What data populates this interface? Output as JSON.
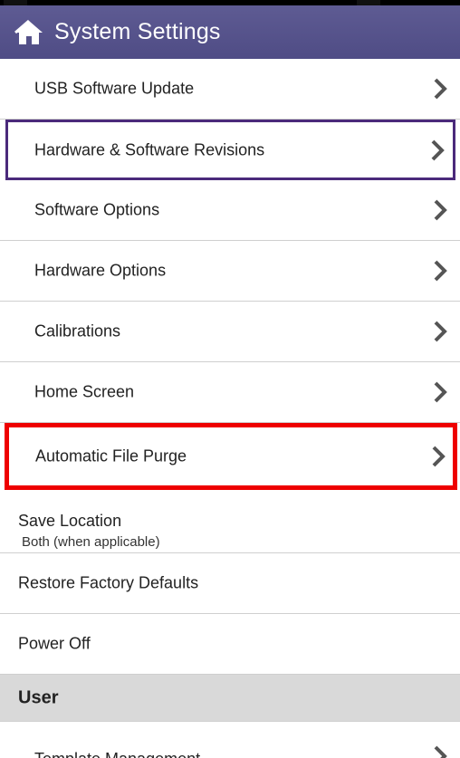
{
  "header": {
    "title": "System Settings",
    "home_icon": "home-icon",
    "background": "#55528b"
  },
  "items": [
    {
      "label": "USB Software Update"
    },
    {
      "label": "Hardware & Software Revisions"
    },
    {
      "label": "Software Options"
    },
    {
      "label": "Hardware Options"
    },
    {
      "label": "Calibrations"
    },
    {
      "label": "Home Screen"
    },
    {
      "label": "Automatic File Purge"
    }
  ],
  "save_location": {
    "label": "Save Location",
    "value": "Both (when applicable)"
  },
  "restore_defaults": {
    "label": "Restore Factory Defaults"
  },
  "power_off": {
    "label": "Power Off"
  },
  "section_user": {
    "label": "User"
  },
  "partial_item": {
    "label": "Template Management"
  },
  "colors": {
    "selected_border": "#4b2a7b",
    "highlight_border": "#ee0000",
    "chevron": "#555555"
  }
}
